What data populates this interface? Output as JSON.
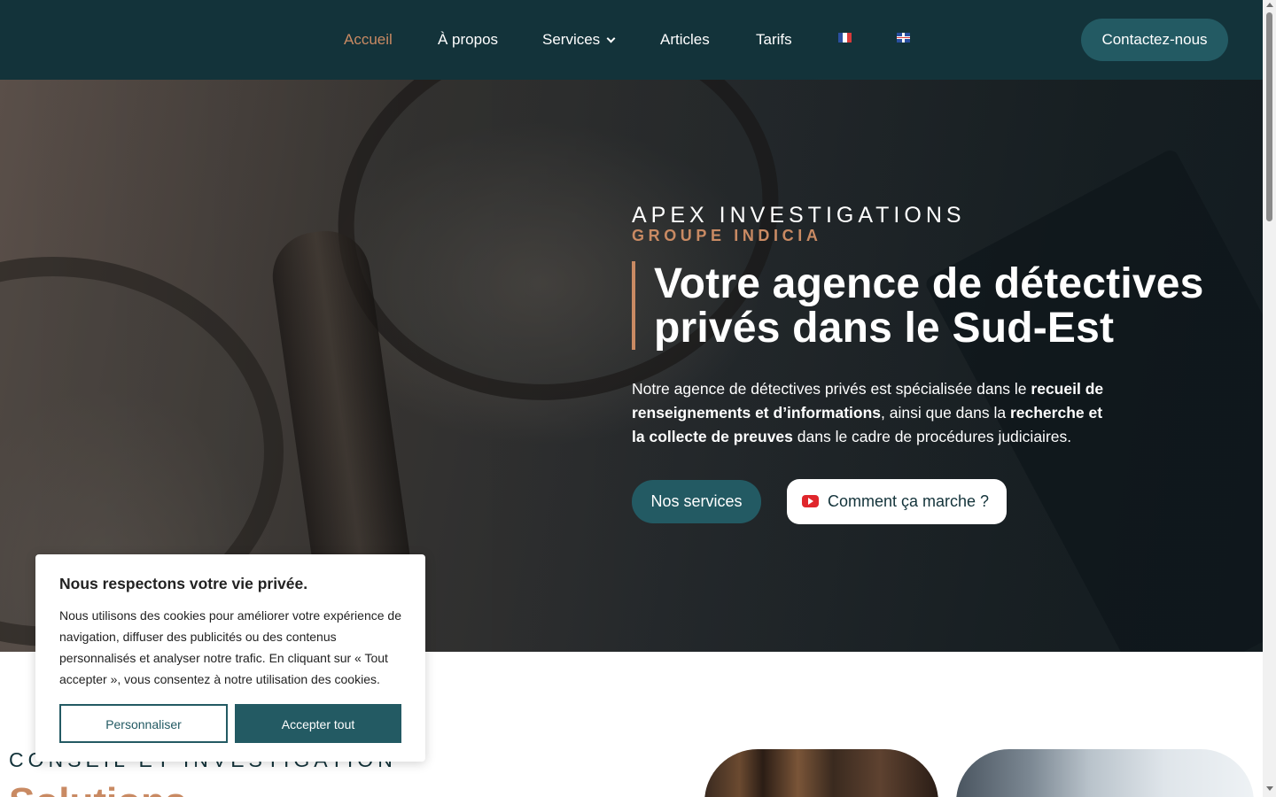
{
  "nav": {
    "items": [
      {
        "label": "Accueil",
        "active": true
      },
      {
        "label": "À propos"
      },
      {
        "label": "Services",
        "has_dropdown": true
      },
      {
        "label": "Articles"
      },
      {
        "label": "Tarifs"
      }
    ],
    "languages": [
      {
        "code": "fr",
        "icon": "french-flag-icon"
      },
      {
        "code": "en",
        "icon": "uk-flag-icon"
      }
    ],
    "contact_label": "Contactez-nous"
  },
  "hero": {
    "brand": "APEX INVESTIGATIONS",
    "brand_sub": "GROUPE INDICIA",
    "title": "Votre agence de détectives privés dans le Sud-Est",
    "desc": {
      "p1": "Notre agence de détectives privés est spécialisée dans le ",
      "b1": "recueil de renseignements et d’informations",
      "p2": ", ainsi que dans la ",
      "b2": "recherche et la collecte de preuves",
      "p3": " dans le cadre de procédures judiciaires."
    },
    "btn_services": "Nos services",
    "btn_how": "Comment ça marche ?"
  },
  "section": {
    "label": "CONSEIL ET INVESTIGATION",
    "title": "Solutions"
  },
  "cookie": {
    "title": "Nous respectons votre vie privée.",
    "text": "Nous utilisons des cookies pour améliorer votre expérience de navigation, diffuser des publicités ou des contenus personnalisés et analyser notre trafic. En cliquant sur « Tout accepter », vous consentez à notre utilisation des cookies.",
    "btn_personalize": "Personnaliser",
    "btn_accept": "Accepter tout"
  },
  "colors": {
    "nav_bg": "#13333a",
    "accent": "#c98a63",
    "button_teal": "#235a63",
    "youtube_red": "#e0262c"
  }
}
